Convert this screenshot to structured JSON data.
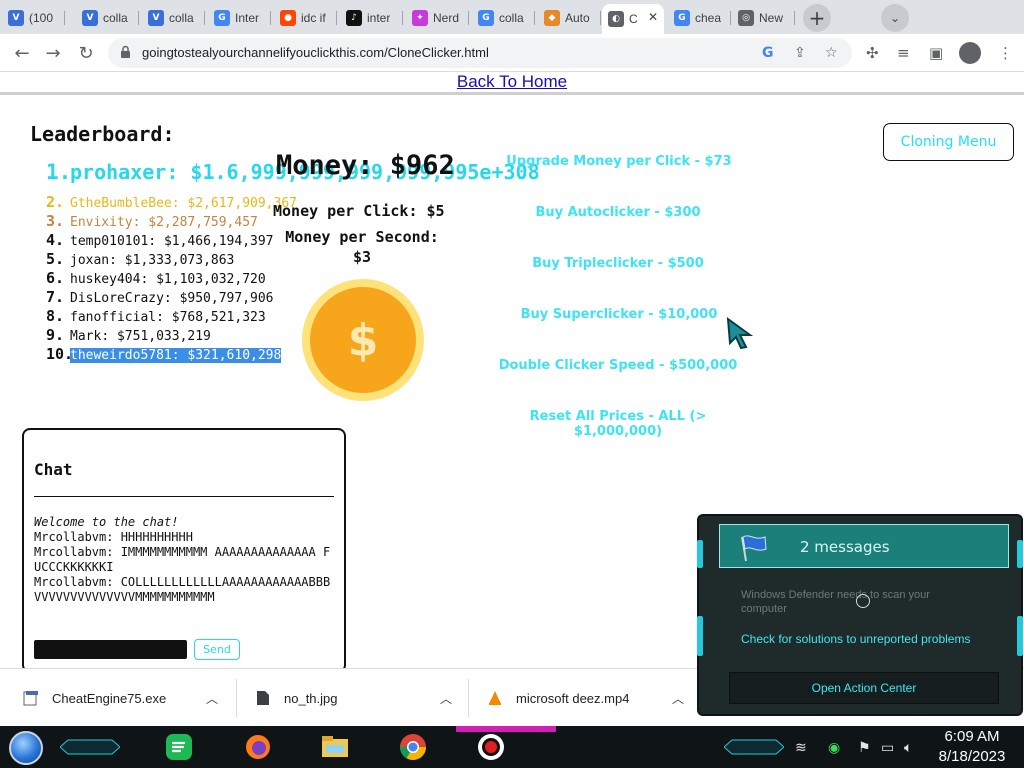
{
  "browser": {
    "tabs": [
      {
        "icon": "vl-icon",
        "title": "(100",
        "color": "#3b6fd8"
      },
      {
        "icon": "vl-icon",
        "title": "colla",
        "color": "#3b6fd8"
      },
      {
        "icon": "vl-icon",
        "title": "colla",
        "color": "#3b6fd8"
      },
      {
        "icon": "google-icon",
        "title": "Inter",
        "color": "#4285f4"
      },
      {
        "icon": "reddit-icon",
        "title": "idc if",
        "color": "#ff4500"
      },
      {
        "icon": "tiktok-icon",
        "title": "inter",
        "color": "#111111"
      },
      {
        "icon": "nerd-icon",
        "title": "Nerd",
        "color": "#c43bd8"
      },
      {
        "icon": "google-icon",
        "title": "colla",
        "color": "#4285f4"
      },
      {
        "icon": "auto-icon",
        "title": "Auto",
        "color": "#e58a2b"
      },
      {
        "icon": "globe-icon",
        "title": "C",
        "color": "#5f6368"
      },
      {
        "icon": "google-icon",
        "title": "chea",
        "color": "#4285f4"
      },
      {
        "icon": "chrome-icon",
        "title": "New",
        "color": "#5f6368"
      }
    ],
    "active_tab": 9,
    "url": "goingtostealyourchannelifyouclickthis.com/CloneClicker.html"
  },
  "page": {
    "back_link": "Back To Home",
    "leaderboard_title": "Leaderboard:",
    "leaderboard": [
      {
        "rank": "1.",
        "name": "prohaxer",
        "money": "$1.6,999,999,999,999,995e+308",
        "color": "#25d8ea"
      },
      {
        "rank": "2.",
        "name": "GtheBumbleBee",
        "money": "$2,617,909,367",
        "color": "#e8b817"
      },
      {
        "rank": "3.",
        "name": "Envixity",
        "money": "$2,287,759,457",
        "color": "#c7843e"
      },
      {
        "rank": "4.",
        "name": "temp010101",
        "money": "$1,466,194,397",
        "color": "#111111"
      },
      {
        "rank": "5.",
        "name": "joxan",
        "money": "$1,333,073,863",
        "color": "#111111"
      },
      {
        "rank": "6.",
        "name": "huskey404",
        "money": "$1,103,032,720",
        "color": "#111111"
      },
      {
        "rank": "7.",
        "name": "DisLoreCrazy",
        "money": "$950,797,906",
        "color": "#111111"
      },
      {
        "rank": "8.",
        "name": "fanofficial",
        "money": "$768,521,323",
        "color": "#111111"
      },
      {
        "rank": "9.",
        "name": "Mark",
        "money": "$751,033,219",
        "color": "#111111"
      },
      {
        "rank": "10.",
        "name": "theweirdo5781",
        "money": "$321,610,298",
        "color": "#ffffff",
        "selected": true
      }
    ],
    "money": "Money: $962",
    "money_per_click": "Money per Click: $5",
    "money_per_second": "Money per Second: $3",
    "coin_symbol": "$",
    "cloning_menu": "Cloning Menu",
    "shop": [
      {
        "label": "Upgrade Money per Click - $73"
      },
      {
        "label": "Buy Autoclicker - $300"
      },
      {
        "label": "Buy Tripleclicker - $500"
      },
      {
        "label": "Buy Superclicker - $10,000"
      },
      {
        "label": "Double Clicker Speed - $500,000"
      },
      {
        "label": "Reset All Prices - ALL (> $1,000,000)"
      }
    ],
    "chat": {
      "title": "Chat",
      "welcome": "Welcome to the chat!",
      "messages": [
        "Mrcollabvm: HHHHHHHHHH",
        "Mrcollabvm: IMMMMMMMMMMM AAAAAAAAAAAAAA FUCCCKKKKKKI",
        "Mrcollabvm: COLLLLLLLLLLLLAAAAAAAAAAAABBBVVVVVVVVVVVVVVMMMMMMMMMMM"
      ],
      "input_value": "",
      "send_label": "Send"
    }
  },
  "downloads": [
    {
      "icon": "exe-icon",
      "name": "CheatEngine75.exe"
    },
    {
      "icon": "image-file-icon",
      "name": "no_th.jpg"
    },
    {
      "icon": "vlc-icon",
      "name": "microsoft deez.mp4"
    }
  ],
  "notification": {
    "count_label": "2 messages",
    "defender_text": "Windows Defender needs to scan your computer",
    "solutions_link": "Check for solutions to unreported problems",
    "action_center": "Open Action Center"
  },
  "taskbar": {
    "time": "6:09 AM",
    "date": "8/18/2023"
  }
}
